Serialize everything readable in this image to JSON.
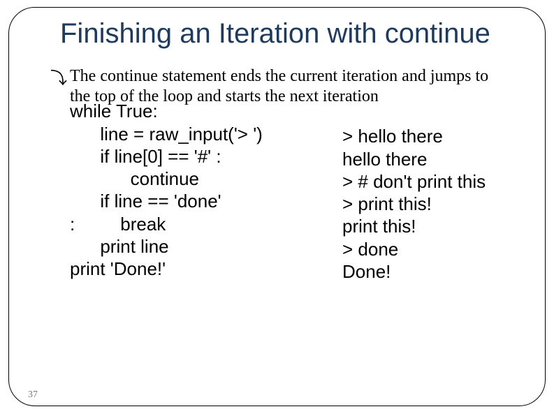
{
  "title": "Finishing an Iteration with continue",
  "bullet_glyph": "⤵",
  "description": "The continue statement ends the current iteration and jumps to the top of the loop and starts the next iteration",
  "code": "while True:\n      line = raw_input('> ')\n      if line[0] == '#' :\n            continue\n      if line == 'done' \n:         break\n      print line\nprint 'Done!'",
  "output": "> hello there\nhello there\n> # don't print this\n> print this!\nprint this!\n> done\nDone!",
  "page_number": "37"
}
